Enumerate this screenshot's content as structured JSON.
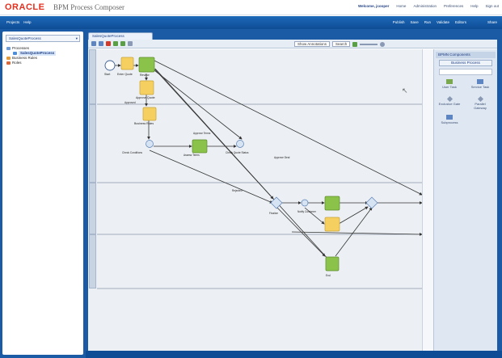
{
  "header": {
    "logo": "ORACLE",
    "title": "BPM Process Composer",
    "links": [
      "Welcome, jcooper",
      "Home",
      "Administration",
      "Preferences",
      "Help",
      "Sign out"
    ]
  },
  "nav": {
    "left_items": [
      "Projects",
      "Help"
    ],
    "right_items": [
      "Publish",
      "Save",
      "Run",
      "Validate",
      "Editors"
    ],
    "far_right": "Share"
  },
  "left_panel": {
    "dropdown": "SalesQuoteProcess",
    "tree": [
      {
        "label": "Processes",
        "level": 0,
        "icon": "folder-icon"
      },
      {
        "label": "SalesQuoteProcess",
        "level": 1,
        "icon": "process-icon",
        "selected": true
      },
      {
        "label": "Business Rules",
        "level": 0,
        "icon": "rules-icon"
      },
      {
        "label": "Roles",
        "level": 0,
        "icon": "roles-icon"
      }
    ]
  },
  "editor": {
    "tab_label": "SalesQuoteProcess",
    "zoom_label": "Show Annotations",
    "search_label": "Search"
  },
  "palette": {
    "title": "BPMN Components",
    "section": "Business Process",
    "items": [
      "User Task",
      "Service Task",
      "Exclusive Gate",
      "Parallel Gateway",
      "Subprocess"
    ]
  },
  "diagram": {
    "labels": {
      "start": "Start",
      "enter_quote": "Enter Quote",
      "review": "Review",
      "approve": "Approve Quote",
      "business_rules": "Business Rules",
      "check_conditions": "Check Conditions",
      "assess_terms": "Assess Terms",
      "check_quote": "Check Quote Status",
      "finalize": "Finalize",
      "notify": "Notify Customer",
      "end": "End",
      "approved": "Approved",
      "rejected": "Rejected",
      "approve_deal": "Approve Deal",
      "approve_terms": "Approve Terms"
    }
  },
  "colors": {
    "nav_blue": "#1565b5",
    "frame_blue": "#1b5aa5",
    "task_yellow": "#f5d060",
    "task_green": "#8bc34a",
    "oracle_red": "#e3301f"
  }
}
